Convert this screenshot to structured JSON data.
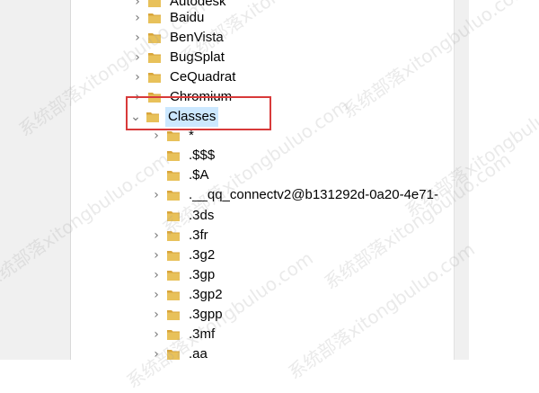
{
  "tree": {
    "items": [
      {
        "label": "Autodesk",
        "chev": "›",
        "icon": "folder-icon"
      },
      {
        "label": "Baidu",
        "chev": "›",
        "icon": "folder-icon"
      },
      {
        "label": "BenVista",
        "chev": "›",
        "icon": "folder-icon"
      },
      {
        "label": "BugSplat",
        "chev": "›",
        "icon": "folder-icon"
      },
      {
        "label": "CeQuadrat",
        "chev": "›",
        "icon": "folder-icon"
      },
      {
        "label": "Chromium",
        "chev": "›",
        "icon": "folder-icon"
      },
      {
        "label": "Classes",
        "chev": "⌄",
        "icon": "folder-icon",
        "selected": true
      },
      {
        "label": "*",
        "chev": "›",
        "icon": "folder-icon"
      },
      {
        "label": ".$$$",
        "chev": "",
        "icon": "folder-icon"
      },
      {
        "label": ".$A",
        "chev": "",
        "icon": "folder-icon"
      },
      {
        "label": ".__qq_connectv2@b131292d-0a20-4e71-",
        "chev": "›",
        "icon": "folder-icon"
      },
      {
        "label": ".3ds",
        "chev": "",
        "icon": "folder-icon"
      },
      {
        "label": ".3fr",
        "chev": "›",
        "icon": "folder-icon"
      },
      {
        "label": ".3g2",
        "chev": "›",
        "icon": "folder-icon"
      },
      {
        "label": ".3gp",
        "chev": "›",
        "icon": "folder-icon"
      },
      {
        "label": ".3gp2",
        "chev": "›",
        "icon": "folder-icon"
      },
      {
        "label": ".3gpp",
        "chev": "›",
        "icon": "folder-icon"
      },
      {
        "label": ".3mf",
        "chev": "›",
        "icon": "folder-icon"
      },
      {
        "label": ".aa",
        "chev": "›",
        "icon": "folder-icon"
      }
    ]
  },
  "watermark": {
    "text": "系统部落xitongbuluo.com"
  },
  "colors": {
    "highlight": "#d83a3a",
    "selection": "#cce8ff",
    "folder": "#e8c15a",
    "folder_dark": "#d9a53a",
    "chevron": "#767676"
  }
}
